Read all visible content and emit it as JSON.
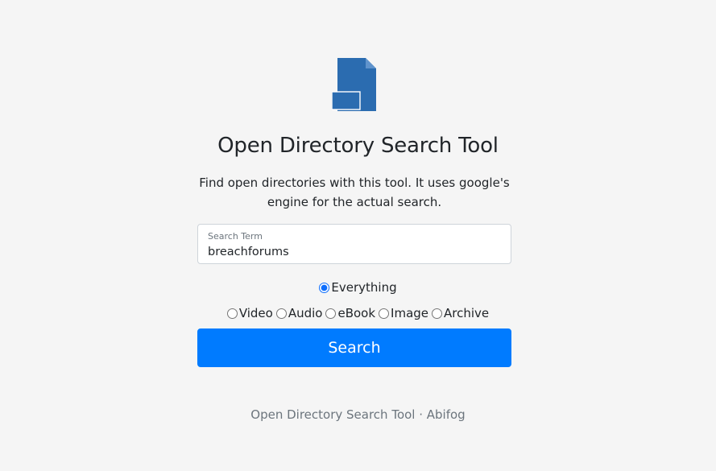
{
  "header": {
    "title": "Open Directory Search Tool",
    "description": "Find open directories with this tool. It uses google's engine for the actual search."
  },
  "search": {
    "label": "Search Term",
    "value": "breachforums",
    "button_label": "Search"
  },
  "filters": {
    "primary": [
      {
        "label": "Everything",
        "checked": true
      }
    ],
    "secondary": [
      {
        "label": "Video",
        "checked": false
      },
      {
        "label": "Audio",
        "checked": false
      },
      {
        "label": "eBook",
        "checked": false
      },
      {
        "label": "Image",
        "checked": false
      },
      {
        "label": "Archive",
        "checked": false
      }
    ]
  },
  "footer": {
    "text": "Open Directory Search Tool · Abifog"
  },
  "colors": {
    "accent": "#007bff",
    "logo": "#2b6cb0",
    "background": "#f5f5f5"
  },
  "icons": {
    "logo": "file-icon"
  }
}
